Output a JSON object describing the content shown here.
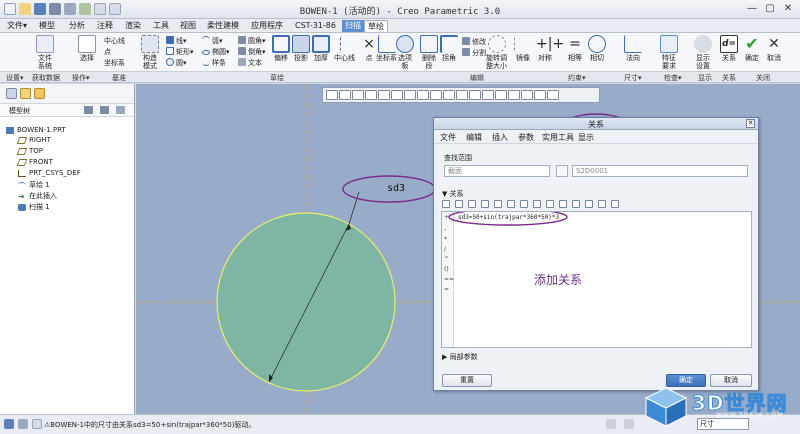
{
  "window": {
    "title": "BOWEN-1 (活动的) - Creo Parametric 3.0",
    "controls": [
      "minimize-icon",
      "restore-icon",
      "close-icon"
    ]
  },
  "menu_tabs": [
    "文件▾",
    "模型",
    "分析",
    "注释",
    "渲染",
    "工具",
    "视图",
    "柔性建模",
    "应用程序",
    "CST-31-86",
    "扫描",
    "草绘"
  ],
  "ribbon": {
    "buttons": [
      {
        "label": "文件\n系统",
        "icon": "file-system-icon"
      },
      {
        "label": "选择",
        "icon": "select-icon"
      },
      {
        "label": "构造\n模式",
        "icon": "construction-mode-icon"
      },
      {
        "label": "偏移",
        "icon": "offset-icon"
      },
      {
        "label": "投影",
        "icon": "project-icon"
      },
      {
        "label": "加厚",
        "icon": "thicken-icon"
      },
      {
        "label": "中心线",
        "icon": "centerline-icon"
      },
      {
        "label": "点",
        "icon": "point-icon"
      },
      {
        "label": "坐标系",
        "icon": "coordinate-system-icon"
      },
      {
        "label": "选项\n板",
        "icon": "palette-icon"
      },
      {
        "label": "删除\n段",
        "icon": "delete-segment-icon"
      },
      {
        "label": "拐角",
        "icon": "corner-icon"
      },
      {
        "label": "旋转调\n整大小",
        "icon": "rotate-resize-icon"
      },
      {
        "label": "镜像",
        "icon": "mirror-icon"
      },
      {
        "label": "对称",
        "icon": "symmetric-icon"
      },
      {
        "label": "相等",
        "icon": "equal-icon"
      },
      {
        "label": "相切",
        "icon": "tangent-icon"
      },
      {
        "label": "法向",
        "icon": "normal-icon"
      },
      {
        "label": "特征\n要求",
        "icon": "feature-requirements-icon"
      },
      {
        "label": "显示\n设置",
        "icon": "display-settings-icon"
      },
      {
        "label": "关系",
        "icon": "relations-icon"
      },
      {
        "label": "确定",
        "icon": "ok-check-icon"
      },
      {
        "label": "取消",
        "icon": "cancel-x-icon"
      }
    ],
    "small_items": [
      "中心线",
      "点",
      "坐标系",
      "线▾",
      "矩形▾",
      "圆▾",
      "弧▾",
      "椭圆▾",
      "样条",
      "圆角▾",
      "倒角▾",
      "文本",
      "修改",
      "分割",
      "拐角"
    ],
    "groups": [
      "设置▾",
      "获取数据",
      "操作▾",
      "基准",
      "草绘",
      "编辑",
      "约束▾",
      "尺寸▾",
      "检查▾",
      "显示",
      "关系",
      "关闭"
    ]
  },
  "model_tree": {
    "header": "模型树",
    "items": [
      {
        "label": "BOWEN-1.PRT",
        "icon": "part-icon"
      },
      {
        "label": "RIGHT",
        "icon": "datum-plane-icon"
      },
      {
        "label": "TOP",
        "icon": "datum-plane-icon"
      },
      {
        "label": "FRONT",
        "icon": "datum-plane-icon"
      },
      {
        "label": "PRT_CSYS_DEF",
        "icon": "csys-icon"
      },
      {
        "label": "草绘 1",
        "icon": "sketch-icon"
      },
      {
        "label": "在此插入",
        "icon": "insert-here-icon"
      },
      {
        "label": "扫描 1",
        "icon": "sweep-icon"
      }
    ]
  },
  "graphics": {
    "annotation_label": "sd3",
    "colors": {
      "background": "#98acc9",
      "circle_fill": "#7fb6a3",
      "circle_edge": "#e8ee6c",
      "axis": "#d4a43c",
      "highlight": "#7a2b8c"
    }
  },
  "dialog": {
    "title": "关系",
    "menu": [
      "文件",
      "编辑",
      "插入",
      "参数",
      "实用工具",
      "显示"
    ],
    "lookup_label": "查找范围",
    "lookup_value": "截面",
    "lookup_target": "S2D0001",
    "relations_label": "▼ 关系",
    "code_line": "sd3=50+sin(trajpar*360*50)*3",
    "gutter_marks": [
      "+",
      "-",
      "*",
      "/",
      "^",
      "()",
      "==",
      "="
    ],
    "annotation": "添加关系",
    "local_params": "▶ 局部参数",
    "reset_button": "重置",
    "ok_button": "确定",
    "cancel_button": "取消"
  },
  "status_bar": {
    "message": "⚠BOWEN-1中的尺寸由关系sd3=50+sin(trajpar*360*50)驱动。",
    "dim_selector": "尺寸"
  },
  "watermark": {
    "text": "3D世界网",
    "url": "WWW.3DSJW.COM"
  }
}
